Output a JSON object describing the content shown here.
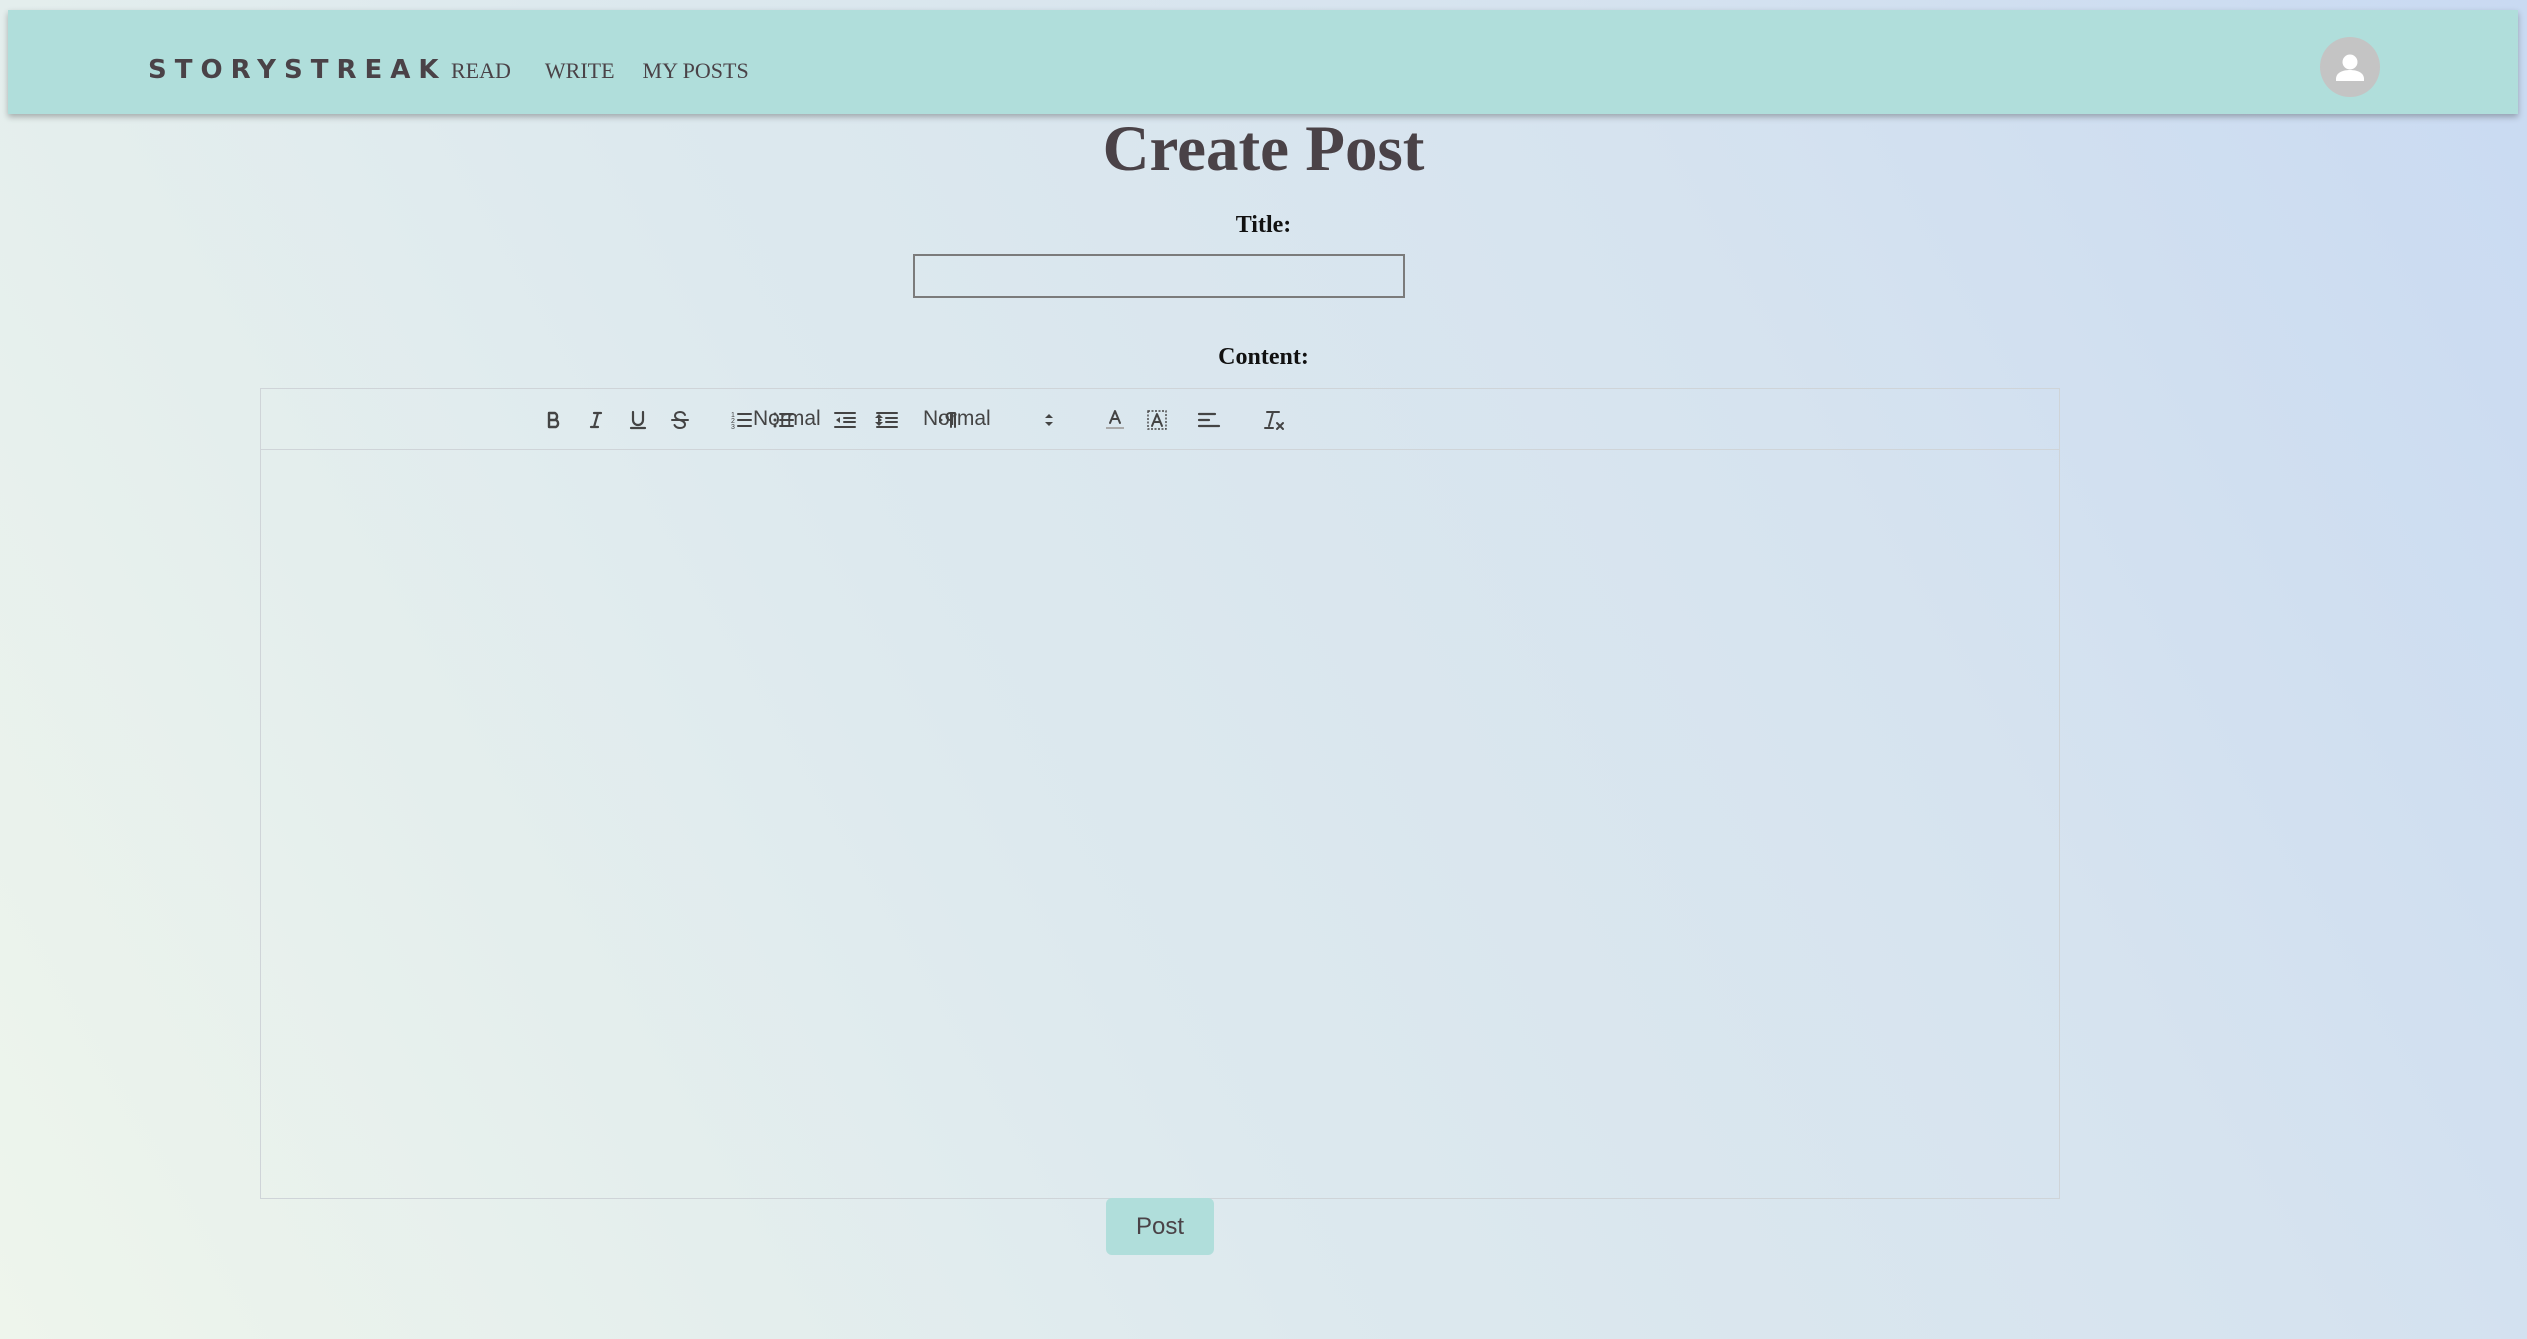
{
  "header": {
    "brand": "STORYSTREAK",
    "nav": [
      {
        "label": "READ"
      },
      {
        "label": "WRITE"
      },
      {
        "label": "MY POSTS"
      }
    ],
    "avatar_icon": "user-icon"
  },
  "main": {
    "title": "Create Post",
    "title_label": "Title:",
    "title_value": "",
    "content_label": "Content:",
    "editor": {
      "toolbar": {
        "icons": [
          "bold-icon",
          "italic-icon",
          "underline-icon",
          "strikethrough-icon",
          "ordered-list-icon",
          "bullet-list-icon",
          "outdent-icon",
          "indent-icon",
          "text-direction-icon",
          "text-color-icon",
          "background-color-icon",
          "align-left-icon",
          "clear-format-icon"
        ],
        "heading_select": "Normal",
        "size_select": "Normal"
      },
      "content": ""
    },
    "submit_label": "Post"
  },
  "colors": {
    "navbar": "#b0dedb",
    "button": "#b0dedb",
    "text_dark": "#4a4247"
  }
}
